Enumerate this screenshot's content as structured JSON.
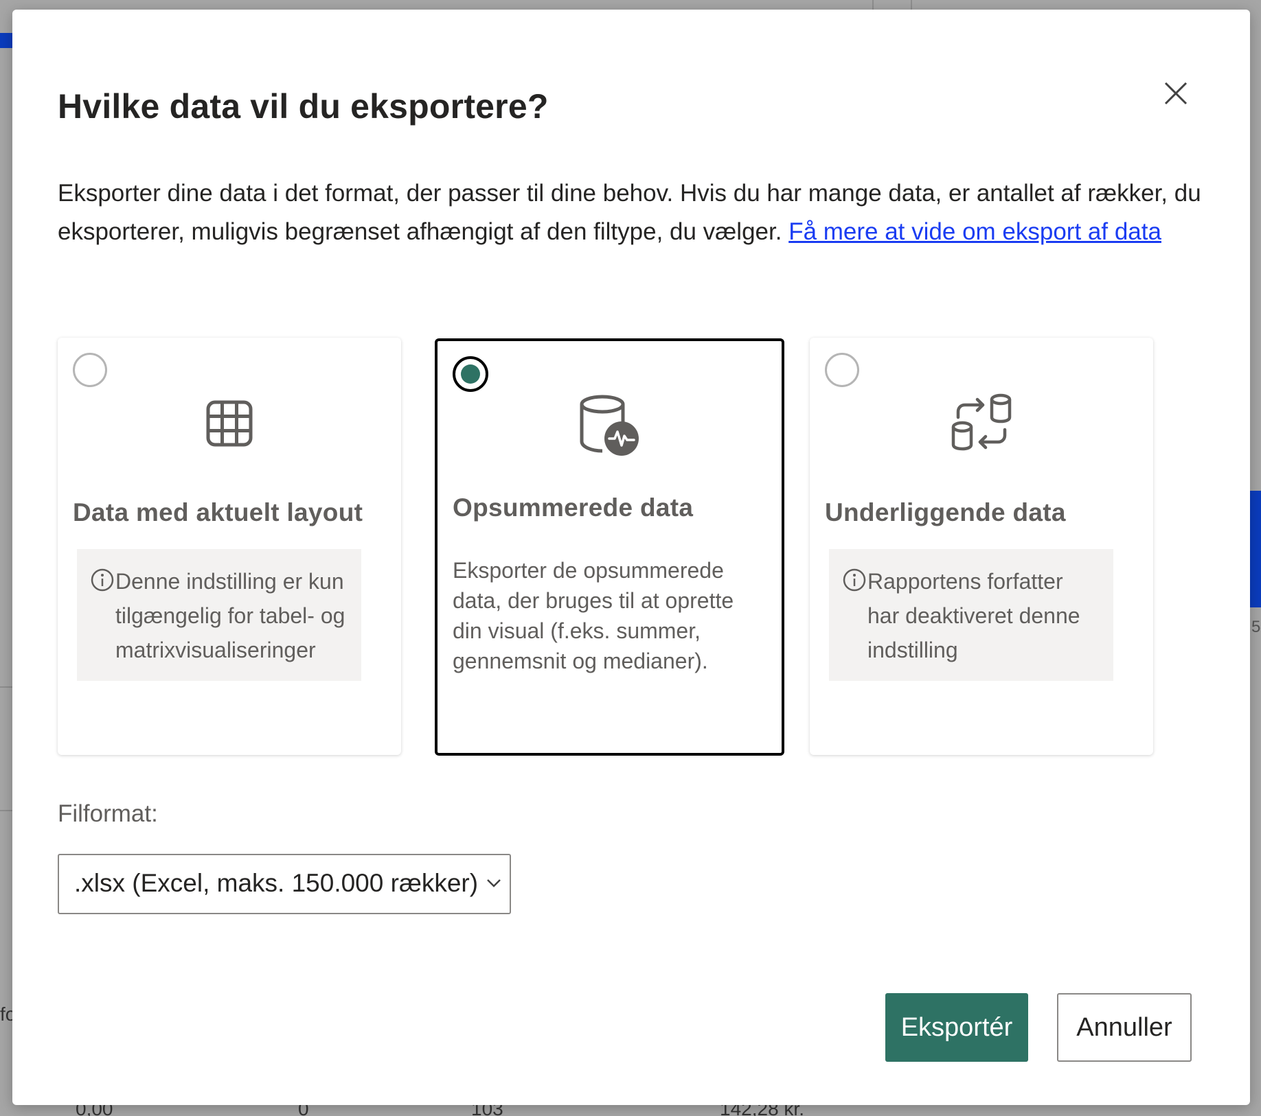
{
  "dialog": {
    "title": "Hvilke data vil du eksportere?",
    "description": "Eksporter dine data i det format, der passer til dine behov. Hvis du har mange data, er antallet af rækker, du eksporterer, muligvis begrænset afhængigt af den filtype, du vælger. ",
    "learn_more_link": "Få mere at vide om eksport af data"
  },
  "options": [
    {
      "title": "Data med aktuelt layout",
      "note": "Denne indstilling er kun tilgængelig for tabel- og matrixvisualiseringer",
      "selected": false,
      "icon": "table-icon"
    },
    {
      "title": "Opsummerede data",
      "description": "Eksporter de opsummerede data, der bruges til at oprette din visual (f.eks. summer, gennemsnit og medianer).",
      "selected": true,
      "icon": "database-activity-icon"
    },
    {
      "title": "Underliggende data",
      "note": "Rapportens forfatter har deaktiveret denne indstilling",
      "selected": false,
      "icon": "database-transfer-icon"
    }
  ],
  "file_format": {
    "label": "Filformat:",
    "selected": ".xlsx (Excel, maks. 150.000 rækker)"
  },
  "buttons": {
    "export": "Eksportér",
    "cancel": "Annuller"
  },
  "background": {
    "left_fragment": "fo",
    "right_fragment": "5",
    "row_values": [
      "0,00",
      "0",
      "103",
      "142,28 kr."
    ]
  },
  "colors": {
    "primary": "#2e7264",
    "link": "#1a3cf2",
    "selected_border": "#000000",
    "background_accent": "#0b3cbd"
  }
}
